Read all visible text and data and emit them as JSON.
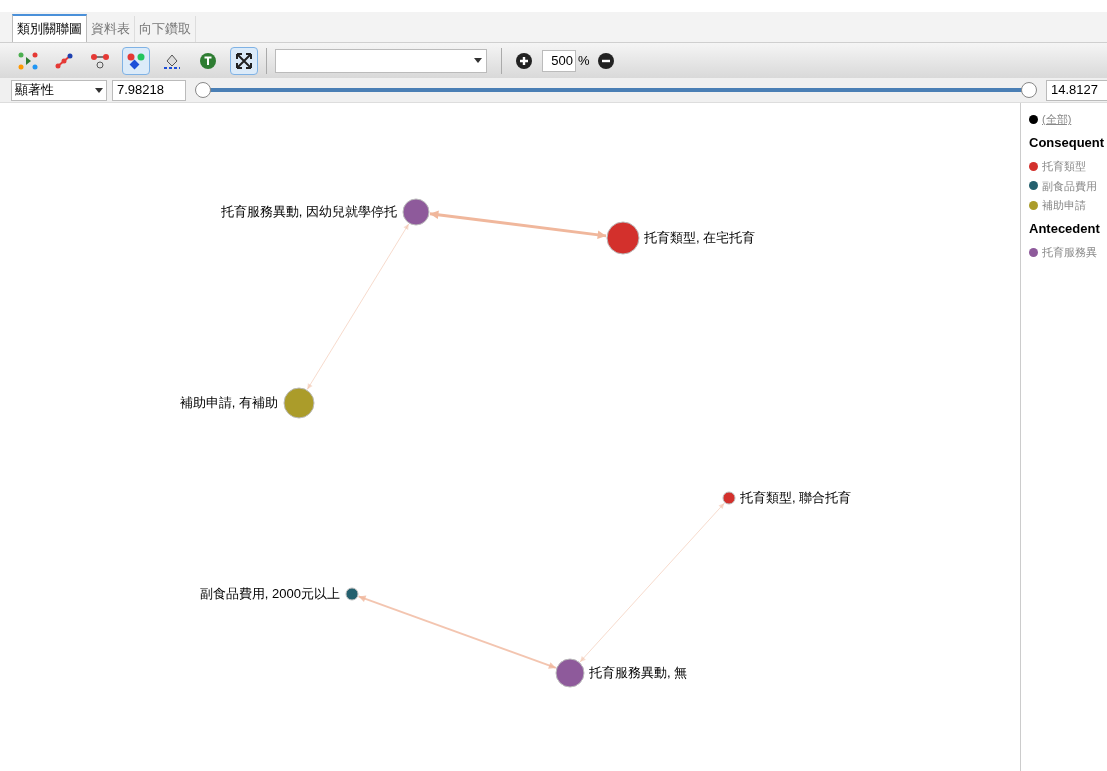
{
  "tabs": [
    {
      "label": "類別關聯圖",
      "selected": true
    },
    {
      "label": "資料表",
      "selected": false
    },
    {
      "label": "向下鑽取",
      "selected": false
    }
  ],
  "toolbar": {
    "tools": [
      {
        "kind": "layout",
        "selected": false
      },
      {
        "kind": "links",
        "selected": false
      },
      {
        "kind": "nodes",
        "selected": false
      },
      {
        "kind": "colors",
        "selected": true
      },
      {
        "kind": "paint",
        "selected": false
      },
      {
        "kind": "text",
        "selected": false
      },
      {
        "kind": "fit",
        "selected": true
      }
    ],
    "zoom": {
      "value": "500",
      "unit": "%"
    }
  },
  "filter": {
    "measure": "顯著性",
    "min_value": "7.98218",
    "max_value": "14.8127",
    "level": 1
  },
  "graph": {
    "nodes": [
      {
        "label": "托育服務異動, 因幼兒就學停托",
        "color": "#8e5a9b"
      },
      {
        "label": "托育類型, 在宅托育",
        "color": "#d3302c"
      },
      {
        "label": "補助申請, 有補助",
        "color": "#ab9c2a"
      },
      {
        "label": "托育類型, 聯合托育",
        "color": "#d3302c"
      },
      {
        "label": "副食品費用, 2000元以上",
        "color": "#24606e"
      },
      {
        "label": "托育服務異動, 無",
        "color": "#8e5a9b"
      }
    ]
  },
  "legend": {
    "all": "(全部)",
    "groups": [
      {
        "title": "Consequent",
        "items": [
          {
            "label": "托育類型",
            "color": "#d3302c"
          },
          {
            "label": "副食品費用",
            "color": "#24606e"
          },
          {
            "label": "補助申請",
            "color": "#ab9c2a"
          }
        ]
      },
      {
        "title": "Antecedent",
        "items": [
          {
            "label": "托育服務異",
            "color": "#8e5a9b"
          }
        ]
      }
    ]
  }
}
